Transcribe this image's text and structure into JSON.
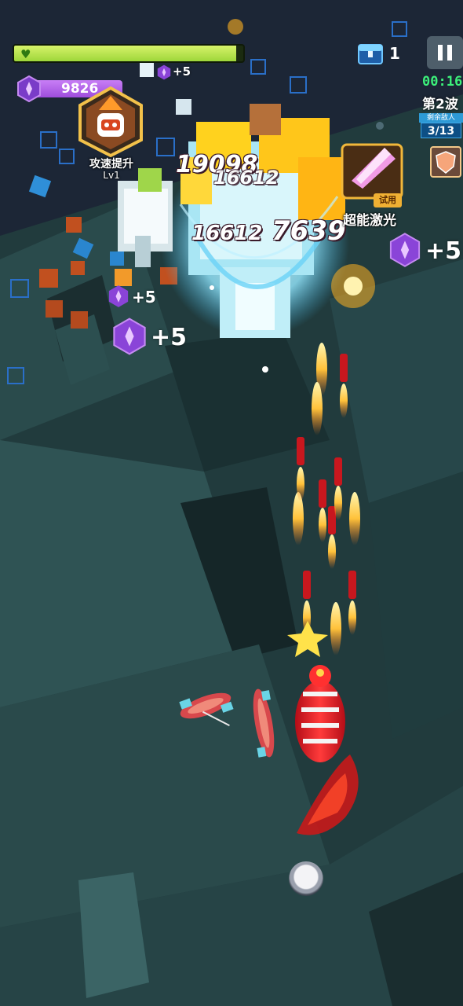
{
  "hud": {
    "health": {
      "fraction": 0.97,
      "icon": "heart-icon"
    },
    "gems": {
      "value": "9826",
      "icon": "purple-gem-icon"
    },
    "gem_pickups": [
      "+5",
      "+5",
      "+5",
      "+5"
    ],
    "buff": {
      "label": "攻速提升",
      "level": "Lv1",
      "icon": "robot-face-icon"
    },
    "chest": {
      "count": "1",
      "icon": "treasure-chest-icon"
    },
    "timer": "00:16",
    "wave": "第2波",
    "enemies": {
      "title": "剩余敌人",
      "value": "3/13"
    },
    "laser_skill": {
      "name": "超能激光",
      "badge": "试用",
      "icon": "laser-crystal-icon"
    }
  },
  "damage_numbers": [
    "19098",
    "16612",
    "16612",
    "7639"
  ],
  "colors": {
    "health": "#a8dd45",
    "gem": "#b060e8",
    "timer": "#3cf07a",
    "enemies_badge": "#0d4f85",
    "trial_badge": "#f0b033"
  }
}
